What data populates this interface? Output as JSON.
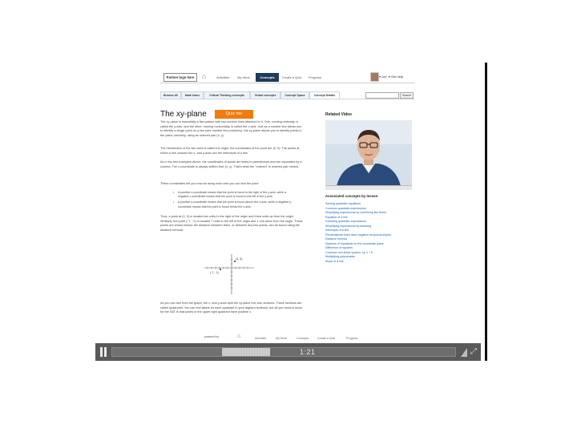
{
  "nav": {
    "logo": "Partner logo here",
    "tabs": [
      "Activities",
      "My Work",
      "Concepts",
      "Create a Quiz",
      "Progress"
    ],
    "active_tab": "Concepts",
    "user": "▾ Joe",
    "help": "▾ Get help"
  },
  "subnav": {
    "tabs": [
      "Browse All",
      "Math Index",
      "Critical Thinking concepts",
      "Verbal concepts",
      "Concept Space",
      "Concept Details"
    ],
    "active_tab": "Concept Details",
    "search_button": "Search"
  },
  "content": {
    "title": "The xy-plane",
    "quiz_button": "Quiz me",
    "para1": "The xy-plane is essentially a flat surface with two number lines attached to it. One, running vertically, is called the y-axis, and the other, running horizontally, is called the x-axis. Just as a number line allows you to identify a single point on a line (see number line problems), the xy-plane allows you to identify points in the plane precisely, using an ordered pair (x, y).",
    "para2": "The intersection of the two axes is called the origin; the coordinates of the point are (0, 0). The points at which a line crosses the x- and y-axes are the intercepts of a line.",
    "para3": "As in the two examples above, the coordinates of points are listed in parentheses and are separated by a comma. The x-coordinate is always written first: (x, y). That's what the \"ordered\" in ordered pair means.",
    "para4": "These coordinates tell you how far along each axis you can find the point.",
    "bullet1": "A positive x-coordinate means that the point is found to the right of the y-axis, while a negative x-coordinate means that the point is found to the left of the y-axis.",
    "bullet2": "A positive y-coordinate means that the point is found above the x-axis, while a negative y-coordinate means that the point is found below the x-axis.",
    "para5": "Thus, a point at (2, 3) is located two units to the right of the origin and three units up from the origin. Similarly, the point (−7, −1) is located 7 units to the left of the origin and 1 unit down from the origin. These points are shown below; the distance between them, or between any two points, can be found using the distance formula.",
    "para6": "As you can see from the graph, the x- and y-axes split the xy-plane into four sections. These sections are called quadrants. You can find labels for each quadrant in your algebra textbook, but all you need to know for the SAT is that points in the upper right quadrant have positive x-",
    "point_a": "(2, 3)",
    "point_b": "(-7, -1)"
  },
  "sidebar": {
    "related_video_title": "Related Video",
    "associated_title": "Associated concepts by lesson",
    "associated": [
      "Solving quadratic equations",
      "Common quadratic expressions",
      "Simplifying expressions by combining like terms",
      "Equation of a line",
      "Factoring quadratic expressions",
      "Simplifying expressions by factoring",
      "Intercepts of a line",
      "Perpendicular lines have negative reciprocal slopes",
      "Distance formula",
      "Systems of equations on the coordinate plane",
      "Difference of squares",
      "Common non-linear system: xy, x + b",
      "Multiplying polynomials",
      "Slope of a line"
    ]
  },
  "footer": {
    "logo": "powered by",
    "items": [
      "Activities",
      "My Work",
      "Concepts",
      "Create a Quiz",
      "Progress"
    ]
  },
  "player": {
    "time": "1:21",
    "played_fraction": 0.32,
    "buffered_fraction": 0.46
  }
}
